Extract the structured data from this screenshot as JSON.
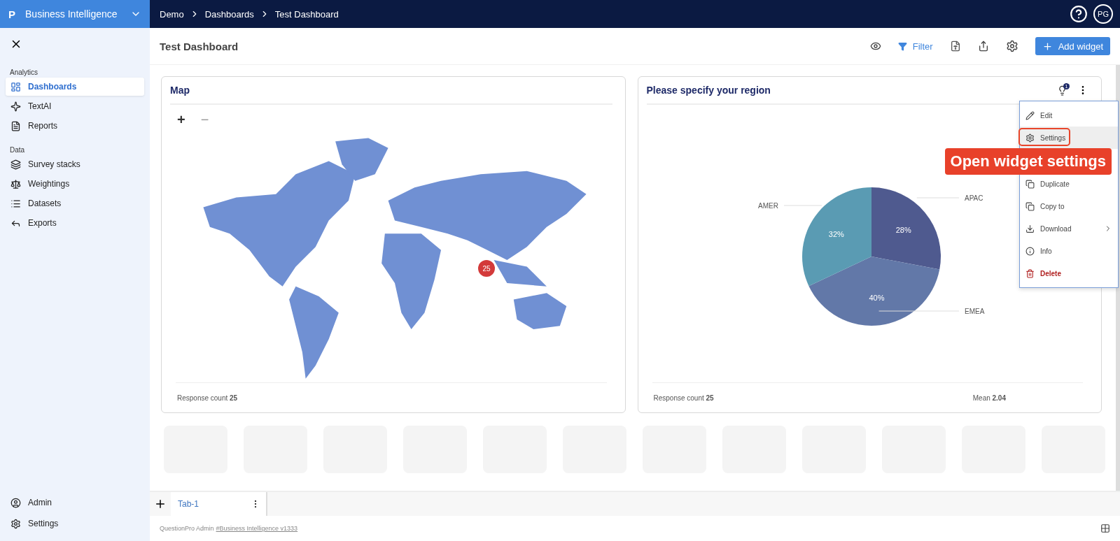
{
  "app": {
    "logo": "P",
    "name": "Business Intelligence"
  },
  "breadcrumbs": [
    "Demo",
    "Dashboards",
    "Test Dashboard"
  ],
  "user": {
    "initials": "PG"
  },
  "sidebar": {
    "sections": [
      {
        "title": "Analytics",
        "items": [
          {
            "label": "Dashboards",
            "selected": true
          },
          {
            "label": "TextAI",
            "selected": false
          },
          {
            "label": "Reports",
            "selected": false
          }
        ]
      },
      {
        "title": "Data",
        "items": [
          {
            "label": "Survey stacks",
            "selected": false
          },
          {
            "label": "Weightings",
            "selected": false
          },
          {
            "label": "Datasets",
            "selected": false
          },
          {
            "label": "Exports",
            "selected": false
          }
        ]
      }
    ],
    "bottom_items": [
      {
        "label": "Admin",
        "selected": false
      },
      {
        "label": "Settings",
        "selected": false
      }
    ]
  },
  "page": {
    "title": "Test Dashboard",
    "filter_label": "Filter",
    "add_button": "Add widget"
  },
  "widgets": [
    {
      "kind": "map",
      "title": "Map",
      "zoom_in": "+",
      "zoom_out": "−",
      "marker": "25",
      "footer": [
        {
          "label": "Response count",
          "value": "25"
        }
      ]
    },
    {
      "kind": "pie",
      "title": "Please specify your region",
      "badge": "1",
      "footer": [
        {
          "label": "Response count",
          "value": "25"
        },
        {
          "label": "Mean",
          "value": "2.04"
        }
      ],
      "chart_data": {
        "type": "pie",
        "categories": [
          "APAC",
          "EMEA",
          "AMER"
        ],
        "values": [
          28,
          40,
          32
        ],
        "data_labels": true,
        "value_labels": [
          "28%",
          "40%",
          "32%"
        ]
      }
    }
  ],
  "context_menu": {
    "items": [
      {
        "label": "Edit",
        "kind": "normal",
        "selected": false
      },
      {
        "label": "Settings",
        "kind": "normal",
        "selected": true
      },
      {
        "label": "Duplicate",
        "kind": "normal",
        "selected": false
      },
      {
        "label": "Copy to",
        "kind": "normal",
        "selected": false
      },
      {
        "label": "Download",
        "kind": "submenu",
        "selected": false
      },
      {
        "label": "Info",
        "kind": "normal",
        "selected": false
      },
      {
        "label": "Delete",
        "kind": "danger",
        "selected": false
      }
    ]
  },
  "callout": {
    "text": "Open widget settings"
  },
  "tabs": [
    {
      "label": "Tab-1",
      "selected": true
    }
  ],
  "footer": {
    "text": "QuestionPro Admin",
    "link": "#Business Intelligence v1333"
  }
}
